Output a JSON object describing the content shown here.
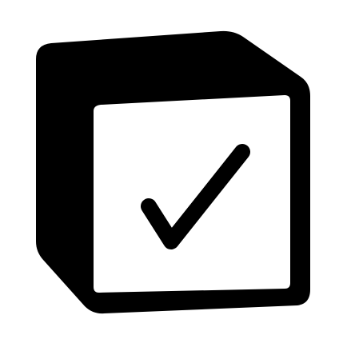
{
  "logo": {
    "icon": "checkbox-cube-icon",
    "fill_color": "#000000",
    "face_color": "#ffffff",
    "check_color": "#000000"
  }
}
